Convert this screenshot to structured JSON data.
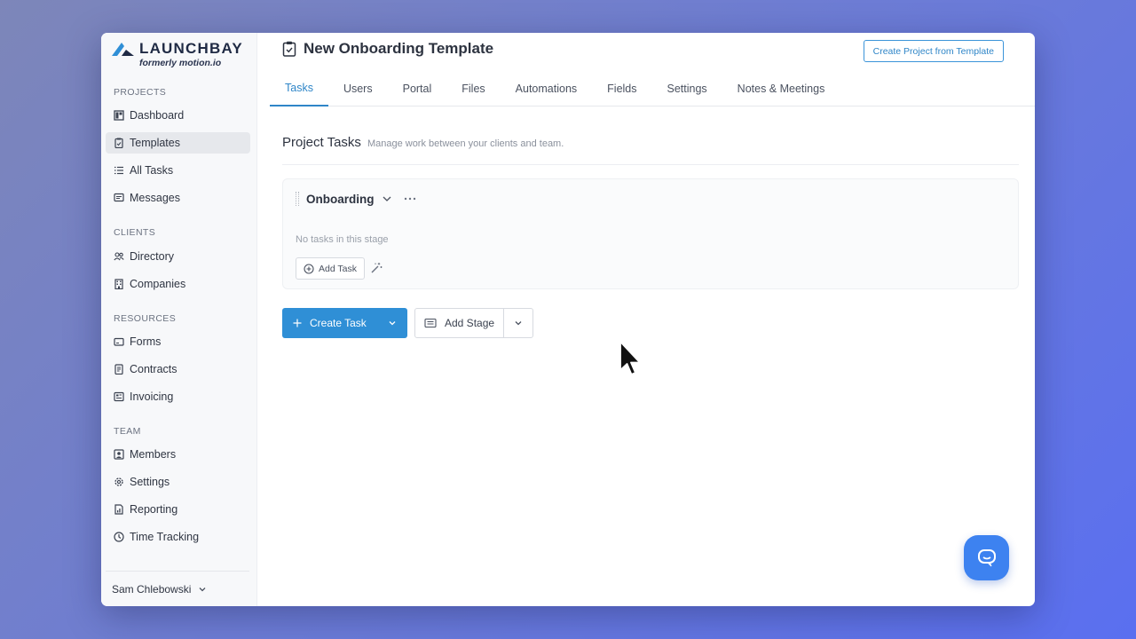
{
  "brand": {
    "name": "LAUNCHBAY",
    "subtitle": "formerly motion.io"
  },
  "sidebar": {
    "sections": [
      {
        "label": "PROJECTS",
        "items": [
          {
            "label": "Dashboard",
            "icon": "dashboard-icon"
          },
          {
            "label": "Templates",
            "icon": "clipboard-icon",
            "active": true
          },
          {
            "label": "All Tasks",
            "icon": "list-icon"
          },
          {
            "label": "Messages",
            "icon": "message-icon"
          }
        ]
      },
      {
        "label": "CLIENTS",
        "items": [
          {
            "label": "Directory",
            "icon": "users-icon"
          },
          {
            "label": "Companies",
            "icon": "building-icon"
          }
        ]
      },
      {
        "label": "RESOURCES",
        "items": [
          {
            "label": "Forms",
            "icon": "form-icon"
          },
          {
            "label": "Contracts",
            "icon": "document-icon"
          },
          {
            "label": "Invoicing",
            "icon": "invoice-icon"
          }
        ]
      },
      {
        "label": "TEAM",
        "items": [
          {
            "label": "Members",
            "icon": "member-icon"
          },
          {
            "label": "Settings",
            "icon": "gear-icon"
          },
          {
            "label": "Reporting",
            "icon": "report-icon"
          },
          {
            "label": "Time Tracking",
            "icon": "clock-icon"
          }
        ]
      }
    ],
    "user": "Sam Chlebowski"
  },
  "header": {
    "title": "New Onboarding Template",
    "create_button": "Create Project from Template"
  },
  "tabs": [
    "Tasks",
    "Users",
    "Portal",
    "Files",
    "Automations",
    "Fields",
    "Settings",
    "Notes & Meetings"
  ],
  "active_tab": "Tasks",
  "tasks_section": {
    "title": "Project Tasks",
    "description": "Manage work between your clients and team.",
    "stage": {
      "name": "Onboarding",
      "empty_text": "No tasks in this stage",
      "add_task": "Add Task"
    },
    "create_task": "Create Task",
    "add_stage": "Add Stage"
  },
  "colors": {
    "accent": "#2f8fd6",
    "chat": "#3d82f0"
  }
}
